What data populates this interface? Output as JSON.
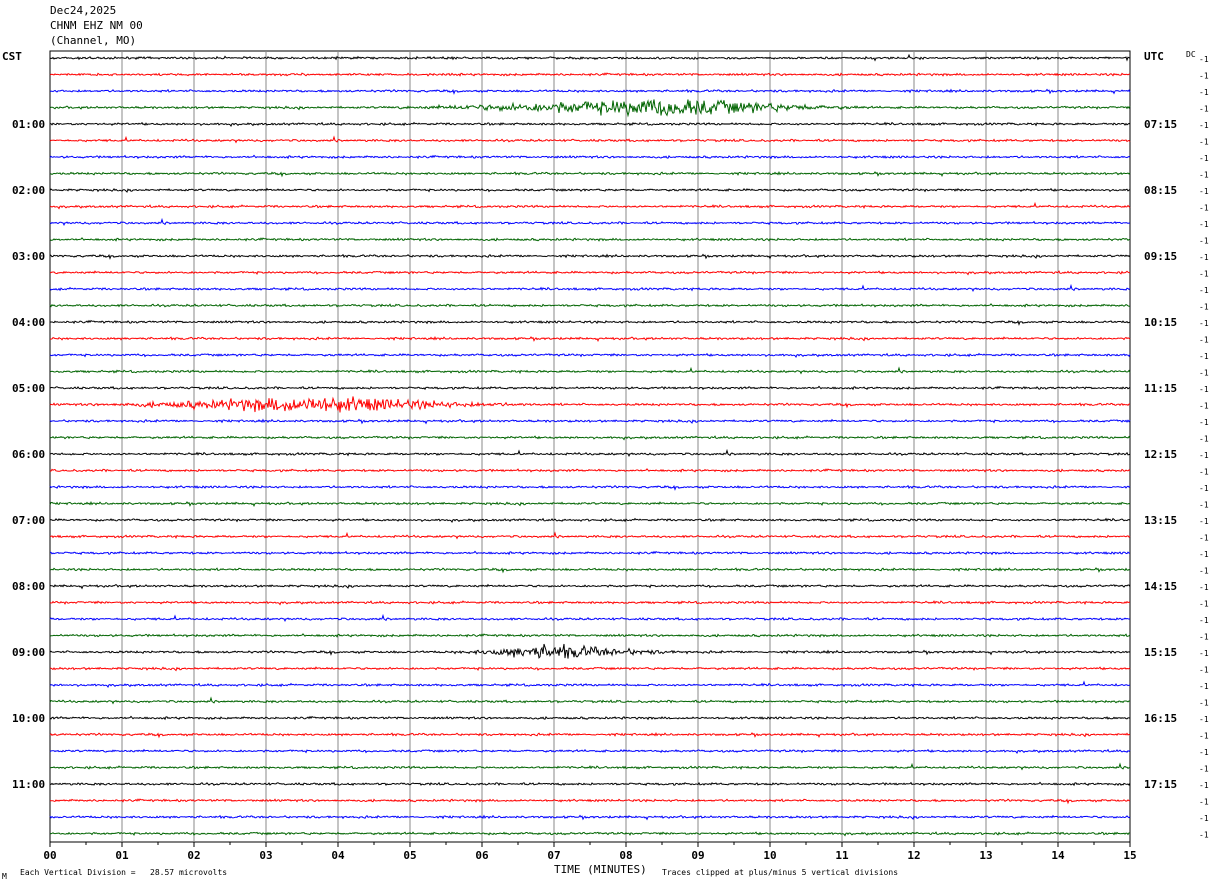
{
  "header": {
    "date": "Dec24,2025",
    "station": "CHNM EHZ NM 00",
    "channel": "(Channel, MO)"
  },
  "left_tz": "CST",
  "right_tz": "UTC",
  "dc_label": "DC",
  "footer": {
    "vertical_division": "Each Vertical Division =   28.57 microvolts",
    "clip_note": "Traces clipped at plus/minus 5 vertical divisions",
    "corner_mark": "M"
  },
  "chart_data": {
    "type": "line",
    "xlabel": "TIME (MINUTES)",
    "xlim": [
      0,
      15
    ],
    "x_ticks": [
      "00",
      "01",
      "02",
      "03",
      "04",
      "05",
      "06",
      "07",
      "08",
      "09",
      "10",
      "11",
      "12",
      "13",
      "14",
      "15"
    ],
    "trace_count": 48,
    "trace_colors": [
      "#000000",
      "#ff0000",
      "#0000ff",
      "#006400"
    ],
    "left_hour_labels": [
      "01:00",
      "02:00",
      "03:00",
      "04:00",
      "05:00",
      "06:00",
      "07:00",
      "08:00",
      "09:00",
      "10:00",
      "11:00"
    ],
    "right_hour_labels": [
      "07:15",
      "08:15",
      "09:15",
      "10:15",
      "11:15",
      "12:15",
      "13:15",
      "14:15",
      "15:15",
      "16:15",
      "17:15"
    ],
    "trace_offset_value": "-1",
    "events": [
      {
        "trace": 3,
        "start_min": 4.5,
        "end_min": 11.5,
        "peak_min": 8.6,
        "amplitude": 8
      },
      {
        "trace": 21,
        "start_min": 0.3,
        "end_min": 7.0,
        "peak_min": 3.7,
        "amplitude": 7
      },
      {
        "trace": 36,
        "start_min": 5.5,
        "end_min": 9.0,
        "peak_min": 6.9,
        "amplitude": 6
      }
    ]
  }
}
